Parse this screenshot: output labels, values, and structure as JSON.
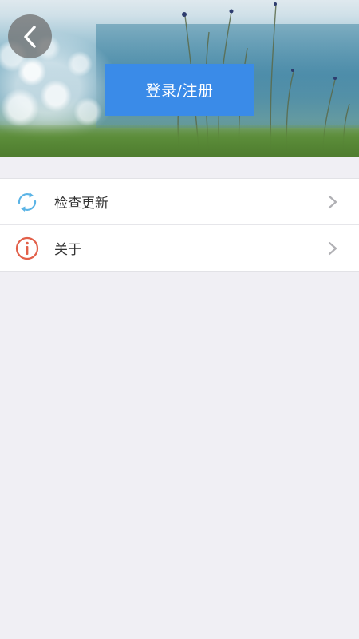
{
  "header": {
    "back_icon": "chevron-left-icon",
    "login_label": "登录/注册"
  },
  "menu": {
    "items": [
      {
        "label": "检查更新",
        "icon": "refresh-icon",
        "icon_color": "#5bb4e6"
      },
      {
        "label": "关于",
        "icon": "info-icon",
        "icon_color": "#e2604a"
      }
    ]
  },
  "colors": {
    "accent": "#3a8be8",
    "background": "#f0eff4"
  }
}
